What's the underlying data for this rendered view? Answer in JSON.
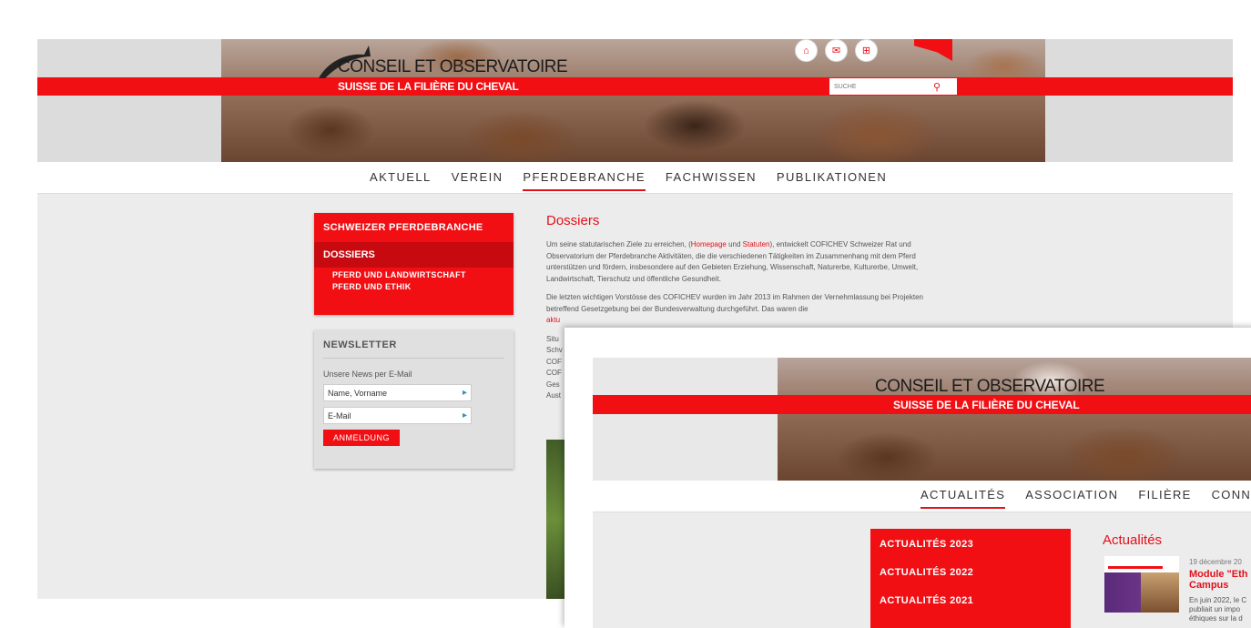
{
  "back_page": {
    "logo": {
      "line1": "CONSEIL ET OBSERVATOIRE",
      "line2": "SUISSE DE LA FILIÈRE DU CHEVAL"
    },
    "top_icons": [
      "home-icon",
      "mail-icon",
      "sitemap-icon"
    ],
    "search": {
      "placeholder": "SUCHE"
    },
    "nav": [
      "AKTUELL",
      "VEREIN",
      "PFERDEBRANCHE",
      "FACHWISSEN",
      "PUBLIKATIONEN"
    ],
    "nav_active": "PFERDEBRANCHE",
    "side_menu": {
      "heading": "SCHWEIZER PFERDEBRANCHE",
      "selected": "DOSSIERS",
      "sub_items": [
        "PFERD UND LANDWIRTSCHAFT",
        "PFERD UND ETHIK"
      ]
    },
    "newsletter": {
      "title": "NEWSLETTER",
      "description": "Unsere News per E-Mail",
      "name_placeholder": "Name, Vorname",
      "email_placeholder": "E-Mail",
      "button": "ANMELDUNG"
    },
    "content": {
      "title": "Dossiers",
      "p1_a": "Um seine statutarischen Ziele zu erreichen, (",
      "p1_link1": "Homepage",
      "p1_b": " und ",
      "p1_link2": "Statuten",
      "p1_c": "), entwickelt COFICHEV Schweizer Rat und Observatorium der Pferdebranche Aktivitäten, die die verschiedenen Tätigkeiten im Zusammenhang mit dem Pferd unterstützen und fördern, insbesondere auf  den Gebieten Erziehung, Wissenschaft, Naturerbe, Kulturerbe, Umwelt, Landwirtschaft, Tierschutz und öffentliche Gesundheit.",
      "p2": "Die letzten wichtigen Vorstösse des COFICHEV wurden im Jahr 2013 im Rahmen der Vernehmlassung bei Projekten betreffend Gesetzgebung bei der Bundesverwaltung durchgeführt. Das waren die",
      "p2_link": "aktu",
      "partial_lines": [
        "Situ",
        "Schv",
        "COF",
        "COF",
        "Ges",
        "Aust"
      ]
    }
  },
  "front_page": {
    "logo": {
      "line1": "CONSEIL ET OBSERVATOIRE",
      "line2": "SUISSE DE LA FILIÈRE DU CHEVAL"
    },
    "nav": [
      "ACTUALITÉS",
      "ASSOCIATION",
      "FILIÈRE",
      "CONN"
    ],
    "nav_active": "ACTUALITÉS",
    "side_menu": [
      "ACTUALITÉS 2023",
      "ACTUALITÉS 2022",
      "ACTUALITÉS 2021"
    ],
    "news": {
      "section_title": "Actualités",
      "date": "19 décembre 20",
      "headline": "Module \"Eth Campus",
      "excerpt": "En juin 2022, le C publiait un impo éthiques sur la d"
    }
  },
  "colors": {
    "brand_red": "#f10f14",
    "dark_red": "#c60a10",
    "link_red": "#e3101a"
  }
}
